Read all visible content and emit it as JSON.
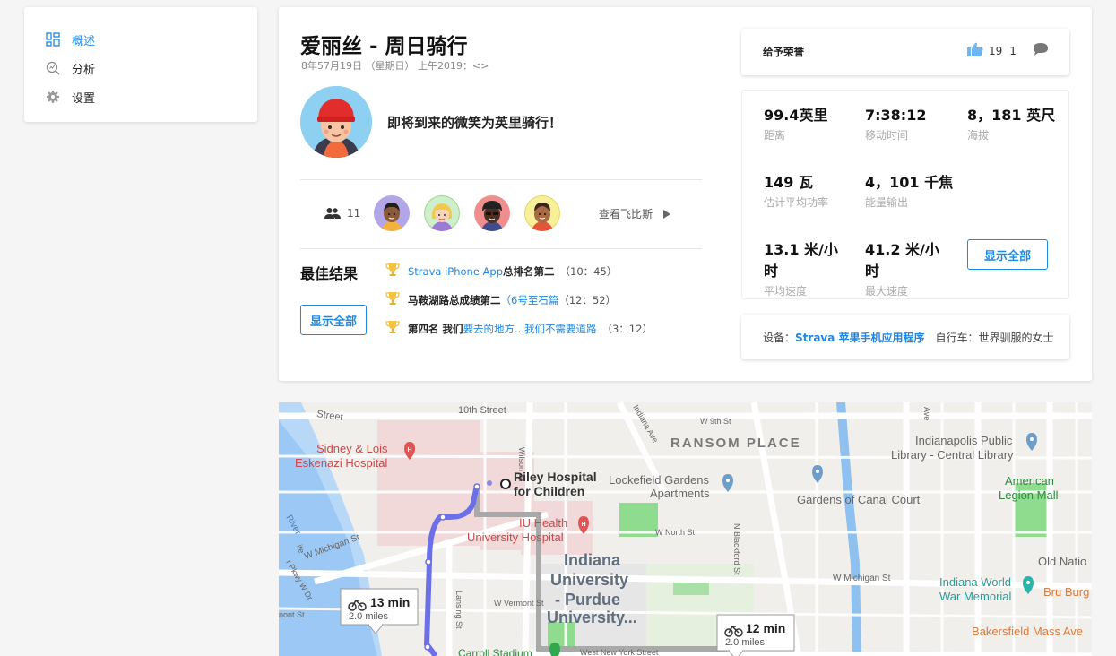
{
  "sidebar": {
    "items": [
      {
        "label": "概述",
        "icon": "overview-icon",
        "active": true
      },
      {
        "label": "分析",
        "icon": "analysis-icon",
        "active": false
      },
      {
        "label": "设置",
        "icon": "gear-icon",
        "active": false
      }
    ]
  },
  "activity": {
    "title": "爱丽丝 - 周日骑行",
    "date": "8年57月19日 （星期日） 上午2019：<>",
    "description": "即将到来的微笑为英里骑行！"
  },
  "group": {
    "count": "11",
    "flyby_label": "查看飞比斯"
  },
  "best_results": {
    "title": "最佳结果",
    "show_all": "显示全部",
    "items": [
      {
        "pre": "",
        "link": "Strava iPhone App",
        "bold": " 总排名第二",
        "time": "（10：45）"
      },
      {
        "pre": "马鞍湖路总成绩第二",
        "link": "（6号至石篇",
        "bold": "",
        "time": "（12：52）"
      },
      {
        "pre": "第四名 我们",
        "link": "要去的地方...我们不需要道路",
        "bold": "",
        "time": "（3：12）"
      }
    ]
  },
  "kudos": {
    "label": "给予荣誉",
    "kudos_count": "19",
    "comment_count": "1"
  },
  "stats": {
    "distance": {
      "value": "99.4英里",
      "label": "距离"
    },
    "moving_time": {
      "value": "7:38:12",
      "label": "移动时间"
    },
    "elevation": {
      "value": "8，181 英尺",
      "label": "海拔"
    },
    "power": {
      "value": "149 瓦",
      "label": "估计平均功率"
    },
    "energy": {
      "value": "4，101 千焦",
      "label": "能量输出"
    },
    "avg_speed": {
      "value": "13.1 米/小时",
      "label": "平均速度"
    },
    "max_speed": {
      "value": "41.2 米/小时",
      "label": "最大速度"
    },
    "show_all": "显示全部"
  },
  "device": {
    "label": "设备：",
    "device_name": "Strava 苹果手机应用程序",
    "bike": "自行车：世界驯服的女士"
  },
  "map": {
    "labels": {
      "st_10th": "10th Street",
      "street_topleft": "Street",
      "ransom": "RANSOM PLACE",
      "indianapolis_lib_1": "Indianapolis Public",
      "indianapolis_lib_2": "Library - Central Library",
      "sidney_1": "Sidney & Lois",
      "sidney_2": "Eskenazi Hospital",
      "riley_1": "Riley Hospital",
      "riley_2": "for Children",
      "lockefield_1": "Lockefield Gardens",
      "lockefield_2": "Apartments",
      "canal": "Gardens of Canal Court",
      "american_1": "American",
      "american_2": "Legion Mall",
      "iu_1": "IU Health",
      "iu_2": "University Hospital",
      "w_michigan": "W Michigan St",
      "w_michigan2": "W Michigan St",
      "w_north": "W North St",
      "indiana_1": "Indiana",
      "indiana_2": "University",
      "indiana_3": "- Purdue",
      "indiana_4": "University...",
      "old_nation": "Old Natio",
      "indiana_war_1": "Indiana World",
      "indiana_war_2": "War Memorial",
      "bru": "Bru Burg",
      "bakersfield": "Bakersfield Mass Ave",
      "carroll": "Carroll Stadium",
      "west_ny": "West New York Street",
      "w_vermont": "W Vermont St",
      "lansing": "Lansing St",
      "wilson": "Wilson St",
      "indiana_ave": "Indiana Ave",
      "w_9th": "W 9th St",
      "river": "River",
      "ite": "ite",
      "pkwy": "r Pkwy W Dr",
      "mont": "nont St",
      "n_blackford": "N Blackford St",
      "ave_right": "Ave"
    },
    "route1": {
      "time": "13 min",
      "dist": "2.0 miles"
    },
    "route2": {
      "time": "12 min",
      "dist": "2.0 miles"
    }
  },
  "colors": {
    "accent": "#1e88e5",
    "route_primary": "#6b6fe8",
    "route_alt": "#a9a9a9",
    "trophy": "#f5c342"
  }
}
